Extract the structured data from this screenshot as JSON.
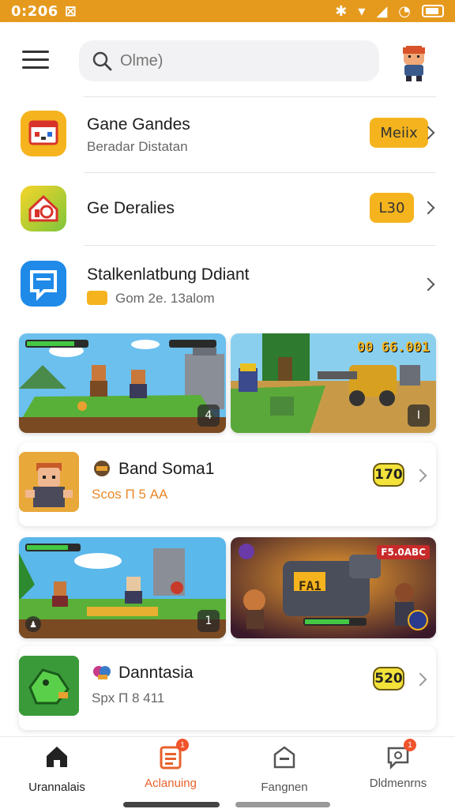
{
  "status": {
    "time": "0:206",
    "extra": "⊠"
  },
  "search": {
    "placeholder": "Olme)"
  },
  "list": [
    {
      "title": "Gane Gandes",
      "subtitle": "Beradar Distatan",
      "badge": "Meiix"
    },
    {
      "title": "Ge Deralies",
      "badge": "L30"
    },
    {
      "title": "Stalkenlatbung Ddiant",
      "subtitle": "Gom 2e. 13alom"
    }
  ],
  "tiles_row1": [
    {
      "hud": "",
      "corner": "4"
    },
    {
      "hud": "00 66.001",
      "corner": "I"
    }
  ],
  "card1": {
    "title": "Band Soma1",
    "subtitle": "Scos П 5 AA",
    "badge": "170"
  },
  "tiles_row2": [
    {
      "corner": "1"
    },
    {
      "hud": "F5.0ABC",
      "label": "FA1"
    }
  ],
  "card2": {
    "title": "Danntasia",
    "subtitle": "Spx П 8 411",
    "badge": "520"
  },
  "nav": [
    {
      "label": "Urannalais"
    },
    {
      "label": "Aclanuing",
      "badge": "1"
    },
    {
      "label": "Fangnen"
    },
    {
      "label": "Dldmenrns",
      "badge": "1"
    }
  ],
  "colors": {
    "accent": "#e59a1e",
    "badge": "#f5b41e",
    "active": "#e8622c"
  }
}
